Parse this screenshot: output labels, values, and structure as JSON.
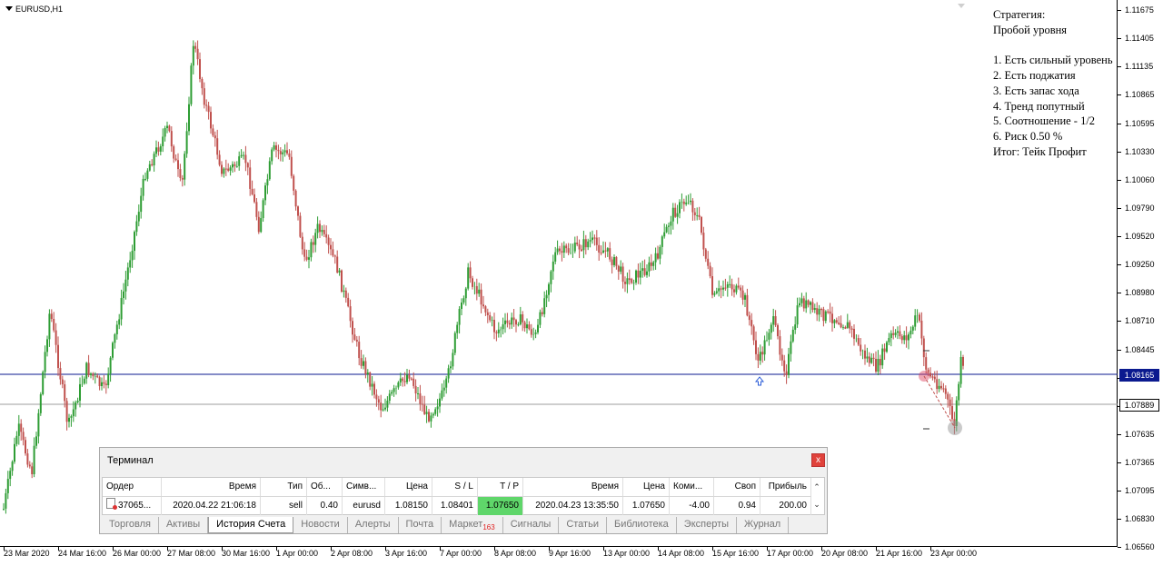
{
  "chart": {
    "symbol_label": "EURUSD,H1",
    "colors": {
      "bull": "#2e9d34",
      "bear": "#c0504d",
      "price_line_blue": "#0b1a8f",
      "price_line_gray": "#9e9e9e"
    },
    "y_labels": [
      "1.11675",
      "1.11405",
      "1.11135",
      "1.10865",
      "1.10595",
      "1.10330",
      "1.10060",
      "1.09790",
      "1.09520",
      "1.09250",
      "1.08980",
      "1.08710",
      "1.08445",
      "1.08175",
      "1.07905",
      "1.07635",
      "1.07365",
      "1.07095",
      "1.06830",
      "1.06560"
    ],
    "price_box_blue": "1.08165",
    "price_box_gray": "1.07889",
    "x_labels": [
      "23 Mar 2020",
      "24 Mar 16:00",
      "26 Mar 00:00",
      "27 Mar 08:00",
      "30 Mar 16:00",
      "1 Apr 00:00",
      "2 Apr 08:00",
      "3 Apr 16:00",
      "7 Apr 00:00",
      "8 Apr 08:00",
      "9 Apr 16:00",
      "13 Apr 00:00",
      "14 Apr 08:00",
      "15 Apr 16:00",
      "17 Apr 00:00",
      "20 Apr 08:00",
      "21 Apr 16:00",
      "23 Apr 00:00"
    ]
  },
  "strategy": {
    "title": "Стратегия:",
    "name": "Пробой уровня",
    "items": [
      "1. Есть сильный уровень",
      "2. Есть поджатия",
      "3. Есть запас хода",
      "4. Тренд попутный",
      "5. Соотношение - 1/2",
      "6. Риск 0.50 %"
    ],
    "result": "Итог: Тейк Профит"
  },
  "terminal": {
    "title": "Терминал",
    "close": "x",
    "columns": [
      "Ордер",
      "Время",
      "Тип",
      "Об...",
      "Симв...",
      "Цена",
      "S / L",
      "T / P",
      "Время",
      "Цена",
      "Коми...",
      "Своп",
      "Прибыль"
    ],
    "row": [
      "37065...",
      "2020.04.22 21:06:18",
      "sell",
      "0.40",
      "eurusd",
      "1.08150",
      "1.08401",
      "1.07650",
      "2020.04.23 13:35:50",
      "1.07650",
      "-4.00",
      "0.94",
      "200.00"
    ],
    "tabs": [
      "Торговля",
      "Активы",
      "История Счета",
      "Новости",
      "Алерты",
      "Почта",
      "Маркет",
      "Сигналы",
      "Статьи",
      "Библиотека",
      "Эксперты",
      "Журнал"
    ],
    "market_badge": "163",
    "active_tab": "История Счета"
  }
}
